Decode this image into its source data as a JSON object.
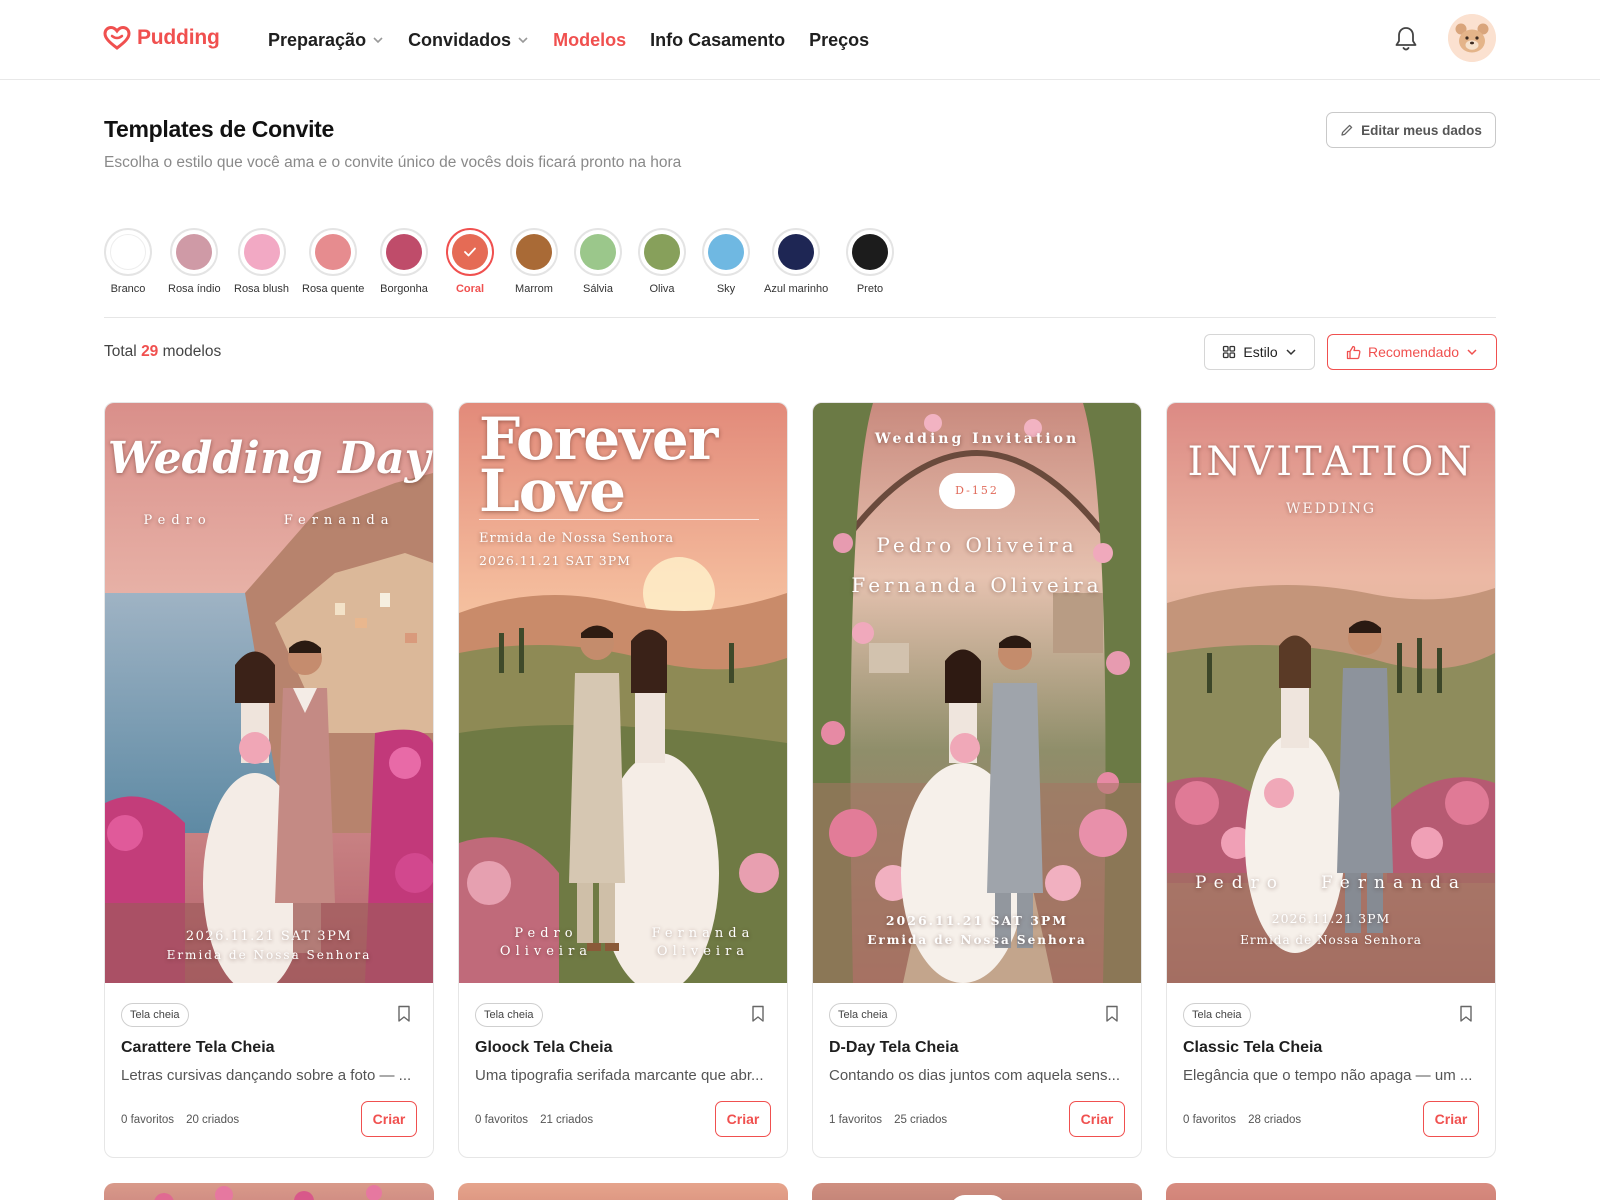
{
  "brand": {
    "name": "Pudding",
    "color": "#f0504f"
  },
  "nav": {
    "items": [
      {
        "label": "Preparação",
        "dropdown": true,
        "active": false
      },
      {
        "label": "Convidados",
        "dropdown": true,
        "active": false
      },
      {
        "label": "Modelos",
        "dropdown": false,
        "active": true
      },
      {
        "label": "Info Casamento",
        "dropdown": false,
        "active": false
      },
      {
        "label": "Preços",
        "dropdown": false,
        "active": false
      }
    ],
    "icons": {
      "notifications": "bell-icon",
      "avatar": "bear-avatar"
    }
  },
  "page": {
    "title": "Templates de Convite",
    "subtitle": "Escolha o estilo que você ama e o convite único de vocês dois ficará pronto na hora",
    "edit_button": "Editar meus dados"
  },
  "colors": {
    "selected": "Coral",
    "items": [
      {
        "label": "Branco",
        "hex": "#ffffff"
      },
      {
        "label": "Rosa índio",
        "hex": "#cf9aa6"
      },
      {
        "label": "Rosa blush",
        "hex": "#f2a9c4"
      },
      {
        "label": "Rosa quente",
        "hex": "#e68c8f"
      },
      {
        "label": "Borgonha",
        "hex": "#bf4c6a"
      },
      {
        "label": "Coral",
        "hex": "#e56b55"
      },
      {
        "label": "Marrom",
        "hex": "#a96a36"
      },
      {
        "label": "Sálvia",
        "hex": "#9bc78b"
      },
      {
        "label": "Oliva",
        "hex": "#87a05b"
      },
      {
        "label": "Sky",
        "hex": "#6fb8e2"
      },
      {
        "label": "Azul marinho",
        "hex": "#1e2654"
      },
      {
        "label": "Preto",
        "hex": "#1c1c1c"
      }
    ]
  },
  "toolbar": {
    "total_prefix": "Total",
    "total_count": "29",
    "total_suffix": "modelos",
    "style_button": "Estilo",
    "sort_button": "Recomendado"
  },
  "cards": [
    {
      "tag": "Tela cheia",
      "title": "Carattere Tela Cheia",
      "description": "Letras cursivas dançando sobre a foto — ...",
      "favorites": "0 favoritos",
      "created": "20 criados",
      "cta": "Criar",
      "overlay": {
        "heading": "Wedding Day",
        "name_left": "Pedro",
        "name_right": "Fernanda",
        "datetime": "2026.11.21 SAT 3PM",
        "venue": "Ermida de Nossa Senhora"
      }
    },
    {
      "tag": "Tela cheia",
      "title": "Gloock Tela Cheia",
      "description": "Uma tipografia serifada marcante que abr...",
      "favorites": "0 favoritos",
      "created": "21 criados",
      "cta": "Criar",
      "overlay": {
        "heading_line1": "Forever",
        "heading_line2": "Love",
        "venue": "Ermida de Nossa Senhora",
        "datetime": "2026.11.21 SAT 3PM",
        "groom_first": "Pedro",
        "groom_last": "Oliveira",
        "bride_first": "Fernanda",
        "bride_last": "Oliveira"
      }
    },
    {
      "tag": "Tela cheia",
      "title": "D-Day Tela Cheia",
      "description": "Contando os dias juntos com aquela sens...",
      "favorites": "1 favoritos",
      "created": "25 criados",
      "cta": "Criar",
      "overlay": {
        "heading": "Wedding Invitation",
        "badge": "D-152",
        "name1": "Pedro Oliveira",
        "name2": "Fernanda Oliveira",
        "datetime": "2026.11.21 SAT 3PM",
        "venue": "Ermida de Nossa Senhora"
      }
    },
    {
      "tag": "Tela cheia",
      "title": "Classic Tela Cheia",
      "description": "Elegância que o tempo não apaga — um ...",
      "favorites": "0 favoritos",
      "created": "28 criados",
      "cta": "Criar",
      "overlay": {
        "heading": "INVITATION",
        "subheading": "WEDDING",
        "name_left": "Pedro",
        "name_right": "Fernanda",
        "datetime": "2026.11.21 3PM",
        "venue": "Ermida de Nossa Senhora"
      }
    }
  ]
}
